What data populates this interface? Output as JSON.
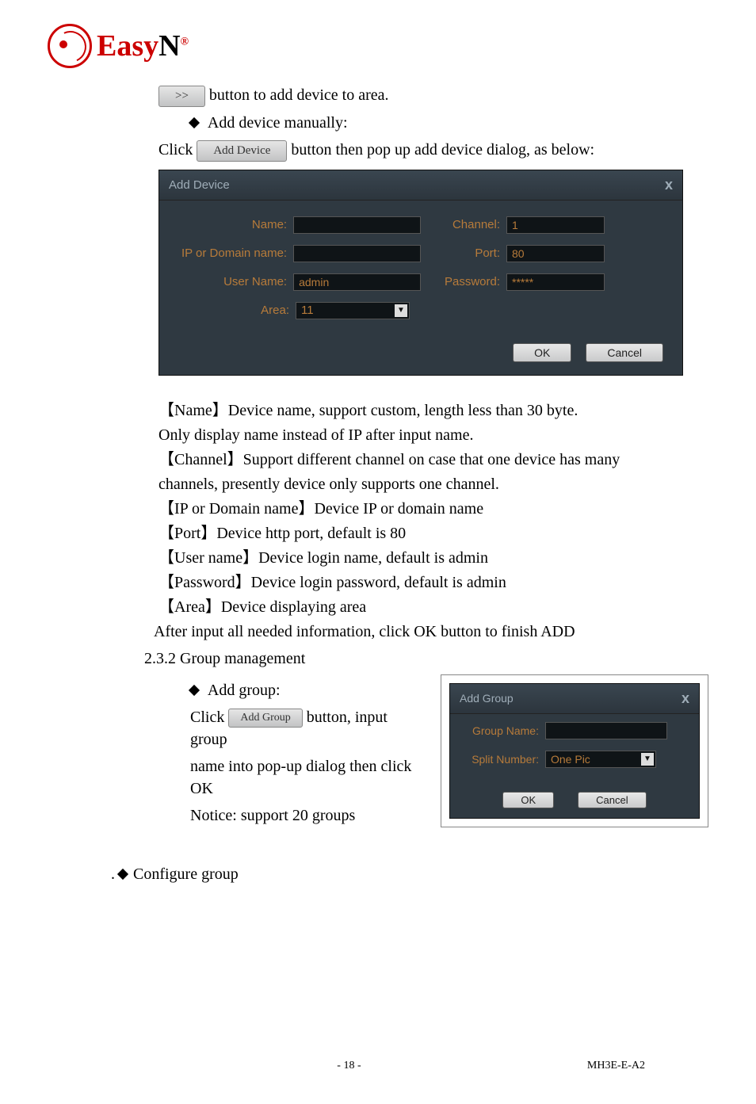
{
  "logo": {
    "text_easy": "Easy",
    "text_n": "N",
    "reg": "®"
  },
  "line1": {
    "btn": ">>",
    "text": "button to add device to area."
  },
  "bullet1": "Add device manually:",
  "line2": {
    "pre": "Click ",
    "btn": "Add Device",
    "post": "button then pop up add device dialog, as below:"
  },
  "dialog1": {
    "title": "Add Device",
    "close": "x",
    "fields": {
      "name_label": "Name:",
      "channel_label": "Channel:",
      "channel_value": "1",
      "ip_label": "IP or Domain name:",
      "port_label": "Port:",
      "port_value": "80",
      "user_label": "User Name:",
      "user_value": "admin",
      "pwd_label": "Password:",
      "pwd_value": "*****",
      "area_label": "Area:",
      "area_value": "11"
    },
    "ok": "OK",
    "cancel": "Cancel"
  },
  "defs": {
    "name1": "【Name】Device name, support custom, length less than 30 byte.",
    "name2": "Only display name instead of IP after input name.",
    "channel1": "【Channel】Support different channel on case that one device has many",
    "channel2": "channels, presently device only supports one channel.",
    "ip": "【IP or Domain name】Device IP or domain name",
    "port": "【Port】Device http port, default is 80",
    "user": "【User name】Device login name, default is admin",
    "pwd": "【Password】Device login password, default is admin",
    "area": "【Area】Device displaying area",
    "after": "After input all needed information, click OK button to finish ADD"
  },
  "group_section_title": "2.3.2 Group management",
  "bullet2": "Add group:",
  "group_click": {
    "pre": "Click ",
    "btn": "Add Group",
    "post": " button, input group"
  },
  "group_line2": "name into pop-up dialog then click OK",
  "group_notice": "Notice: support 20 groups",
  "dialog2": {
    "title": "Add Group",
    "close": "x",
    "name_label": "Group Name:",
    "split_label": "Split Number:",
    "split_value": "One Pic",
    "ok": "OK",
    "cancel": "Cancel"
  },
  "configure": "Configure group",
  "footer": {
    "page": "- 18 -",
    "doc": "MH3E-E-A2"
  }
}
